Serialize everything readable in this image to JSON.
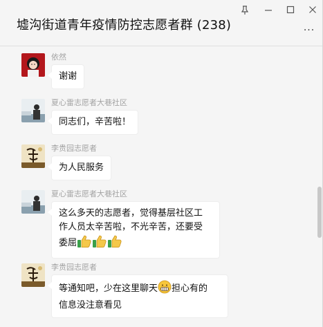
{
  "window": {
    "title": "墟沟街道青年疫情防控志愿者群 (238)",
    "controls": {
      "pin": "pin-icon",
      "minimize": "minimize-icon",
      "maximize": "maximize-icon",
      "close": "close-icon"
    },
    "more": "···"
  },
  "messages": [
    {
      "sender": "依然",
      "text": "谢谢",
      "avatar": "red-cartoon-avatar"
    },
    {
      "sender": "夏心雷志愿者大巷社区",
      "text": "同志们，辛苦啦！",
      "avatar": "person-photo-avatar"
    },
    {
      "sender": "李贵园志愿者",
      "text": "为人民服务",
      "avatar": "calligraphy-li-avatar"
    },
    {
      "sender": "夏心雷志愿者大巷社区",
      "text_lines": [
        "这么多天的志愿者，觉得基层社区工",
        "作人员太辛苦啦，不光辛苦，还要受",
        "委屈"
      ],
      "emojis": [
        "thumbs-up-emoji",
        "thumbs-up-emoji",
        "thumbs-up-emoji"
      ],
      "avatar": "person-photo-avatar"
    },
    {
      "sender": "李贵园志愿者",
      "text_line1_a": "等通知吧，少在这里聊天",
      "text_line1_b": "担心有的",
      "text_line2": "信息没注意看见",
      "emoji": "grin-emoji",
      "avatar": "calligraphy-li-avatar"
    }
  ],
  "colors": {
    "bubble": "#ffffff",
    "background": "#f5f5f5",
    "sender_name": "#a3a3a3"
  }
}
